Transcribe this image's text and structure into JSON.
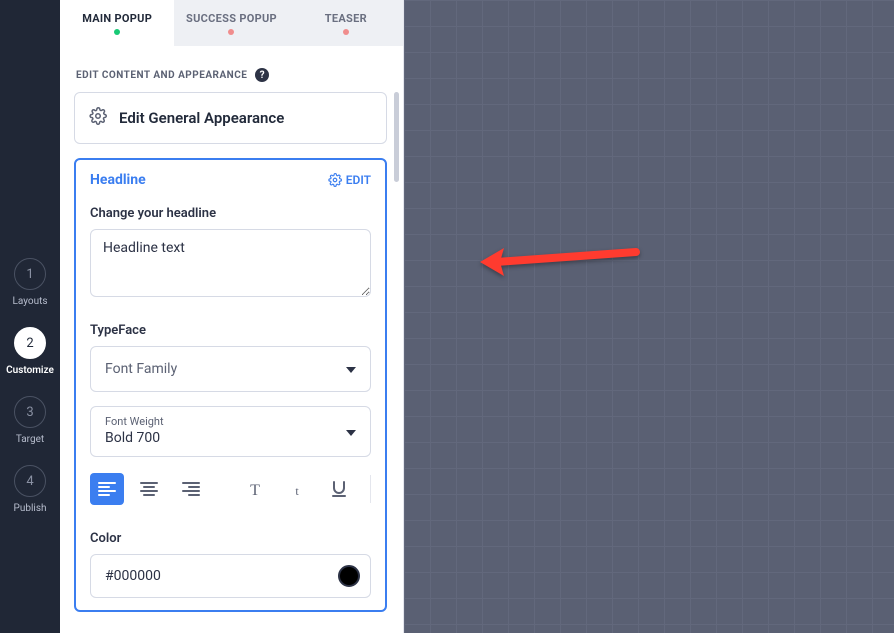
{
  "steps": {
    "s1": {
      "num": "1",
      "label": "Layouts"
    },
    "s2": {
      "num": "2",
      "label": "Customize"
    },
    "s3": {
      "num": "3",
      "label": "Target"
    },
    "s4": {
      "num": "4",
      "label": "Publish"
    }
  },
  "tabs": {
    "main": {
      "label": "MAIN POPUP"
    },
    "success": {
      "label": "SUCCESS POPUP"
    },
    "teaser": {
      "label": "TEASER"
    }
  },
  "section_title": "EDIT CONTENT AND APPEARANCE",
  "general_card_label": "Edit General Appearance",
  "headline": {
    "block_title": "Headline",
    "edit_label": "EDIT",
    "field_label": "Change your headline",
    "value": "Headline text"
  },
  "typeface": {
    "title": "TypeFace",
    "font_family_placeholder": "Font Family",
    "font_weight_label": "Font Weight",
    "font_weight_value": "Bold 700"
  },
  "color": {
    "title": "Color",
    "value": "#000000"
  }
}
